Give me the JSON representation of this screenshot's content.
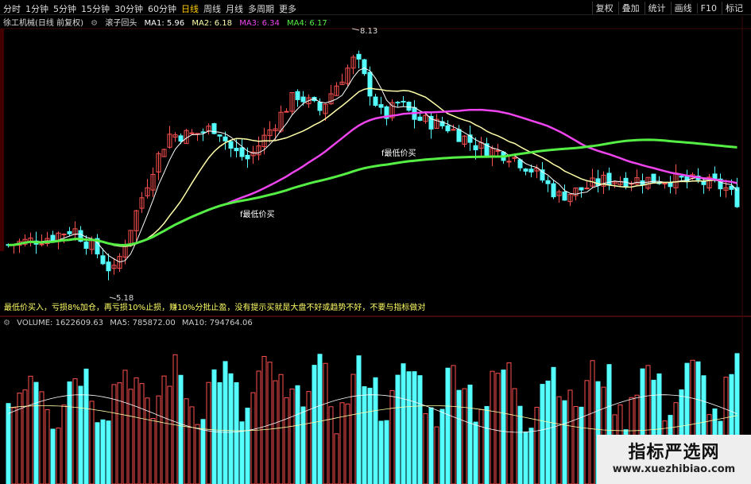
{
  "toolbar": {
    "periods": [
      "分时",
      "1分钟",
      "5分钟",
      "15分钟",
      "30分钟",
      "60分钟",
      "日线",
      "周线",
      "月线",
      "多周期",
      "更多"
    ],
    "active_period": "日线",
    "tools": [
      "复权",
      "叠加",
      "统计",
      "画线",
      "F10",
      "标记"
    ]
  },
  "stock": {
    "name": "徐工机械(日线 前复权)",
    "indicator": "滚子回头",
    "ma1": "MA1: 5.96",
    "ma2": "MA2: 6.18",
    "ma3": "MA3: 6.34",
    "ma4": "MA4: 6.17"
  },
  "annotations": {
    "high": "8.13",
    "low": "5.18",
    "signal1": "f最低价买",
    "signal2": "f最低价买",
    "note": "最低价买入，亏损8%加仓，再亏损10%止损，赚10%分批止盈，没有提示买就是大盘不好或趋势不好，不要与指标做对"
  },
  "volume": {
    "label": "VOLUME: 1622609.63",
    "ma5": "MA5: 785872.00",
    "ma10": "MA10: 794764.06"
  },
  "colors": {
    "up": "#ff5050",
    "down": "#54ffff",
    "ma1": "#ffffff",
    "ma2": "#ffffaa",
    "ma3": "#ee44ee",
    "ma4": "#55ee44"
  },
  "watermark": {
    "cn": "指标严选网",
    "url": "www.xuezhibiao.com"
  },
  "chart_data": {
    "type": "candlestick",
    "series": [
      {
        "name": "MA1",
        "values": [
          5.96
        ]
      },
      {
        "name": "MA2",
        "values": [
          6.18
        ]
      },
      {
        "name": "MA3",
        "values": [
          6.34
        ]
      },
      {
        "name": "MA4",
        "values": [
          6.17
        ]
      }
    ],
    "high_label": 8.13,
    "low_label": 5.18,
    "volume_series": [
      {
        "name": "VOLUME",
        "values": [
          1622609.63
        ]
      },
      {
        "name": "MA5",
        "values": [
          785872.0
        ]
      },
      {
        "name": "MA10",
        "values": [
          794764.06
        ]
      }
    ]
  }
}
